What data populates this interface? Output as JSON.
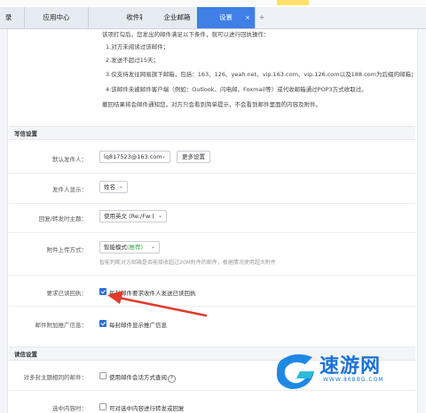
{
  "tabs": [
    {
      "label": "录",
      "active": false
    },
    {
      "label": "应用中心",
      "active": false
    },
    {
      "label": "收件箱",
      "active": false
    },
    {
      "label": "企业邮箱",
      "active": false
    },
    {
      "label": "设置",
      "active": true
    }
  ],
  "tab_close": "×",
  "tab_add": "+",
  "receipt_info": {
    "intro": "该项打勾后，您发出的邮件满足以下条件，就可以进行回执操作：",
    "cond1": "1.对方未阅读过该邮件；",
    "cond2": "2.发送不超过15天；",
    "cond3": "3.仅支持发往网易旗下邮箱，包括：163、126、yeah.net、vip.163.com、vip.126.com以及188.com为后缀的邮箱；",
    "cond4": "4.该邮件未被邮件客户端（例如：Outlook、闪电邮、Foxmail等）或代收邮箱通过POP3方式收取过。",
    "note": "撤回结果将会邮件通知您，对方只会看到简单提示，不会看到邮件里面的内容及附件。"
  },
  "write_settings": {
    "title": "写信设置",
    "default_sender": {
      "label": "默认发件人：",
      "value": "lq817523@163.com",
      "more_button": "更多设置"
    },
    "sender_display": {
      "label": "发件人显示：",
      "value": "姓名"
    },
    "reply_subject": {
      "label": "回复/转发时主题：",
      "value": "使用英文 (Re:/Fw:)"
    },
    "attachment_upload": {
      "label": "附件上传方式：",
      "value": "智能模式",
      "recommend": "(推荐)",
      "hint": "智能判断对方邮箱是否能接收超过20M附件的邮件，根据情况使用超大附件"
    },
    "read_receipt": {
      "label": "要求已读回执：",
      "checkbox": "每封邮件要求收件人发送已读回执",
      "checked": true
    },
    "promo_info": {
      "label": "邮件附加推广信息：",
      "checkbox": "每封邮件显示推广信息",
      "checked": true
    }
  },
  "read_settings": {
    "title": "读信设置",
    "same_subject": {
      "label": "对多封主题相同的邮件：",
      "checkbox": "使用邮件会话方式查阅",
      "help": "?",
      "checked": false
    },
    "selected_content": {
      "label": "选中内容时：",
      "checkbox": "可对选中内容进行转发或回复",
      "checked": false
    }
  },
  "watermark": {
    "name": "速游网",
    "url": "WWW.86BBG.COM"
  },
  "colors": {
    "accent": "#3f7fe6",
    "arrow": "#e23a2c",
    "checkbox": "#2f6fe0",
    "recommend": "#2f9e44"
  }
}
